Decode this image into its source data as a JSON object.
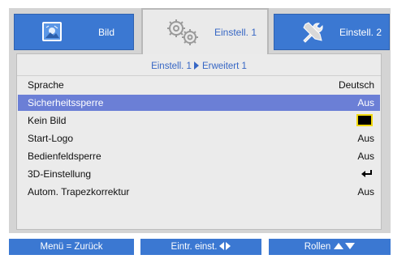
{
  "tabs": [
    {
      "label": "Bild",
      "icon": "picture-icon",
      "active": false
    },
    {
      "label": "Einstell. 1",
      "icon": "gears-icon",
      "active": true
    },
    {
      "label": "Einstell. 2",
      "icon": "tools-icon",
      "active": false
    }
  ],
  "breadcrumb": {
    "parent": "Einstell. 1",
    "current": "Erweitert 1"
  },
  "menu": {
    "rows": [
      {
        "label": "Sprache",
        "value": "Deutsch"
      },
      {
        "label": "Sicherheitssperre",
        "value": "Aus",
        "selected": true
      },
      {
        "label": "Kein Bild",
        "value_icon": "black-screen-swatch"
      },
      {
        "label": "Start-Logo",
        "value": "Aus"
      },
      {
        "label": "Bedienfeldsperre",
        "value": "Aus"
      },
      {
        "label": "3D-Einstellung",
        "value_icon": "enter-icon"
      },
      {
        "label": "Autom. Trapezkorrektur",
        "value": "Aus"
      }
    ]
  },
  "footer": {
    "back": "Menü = Zurück",
    "adjust": "Eintr. einst.",
    "scroll": "Rollen"
  },
  "colors": {
    "accent_blue": "#3b78d2",
    "selection": "#6b7fd6",
    "text_blue": "#3666c4",
    "swatch_border": "#f1d80a"
  }
}
